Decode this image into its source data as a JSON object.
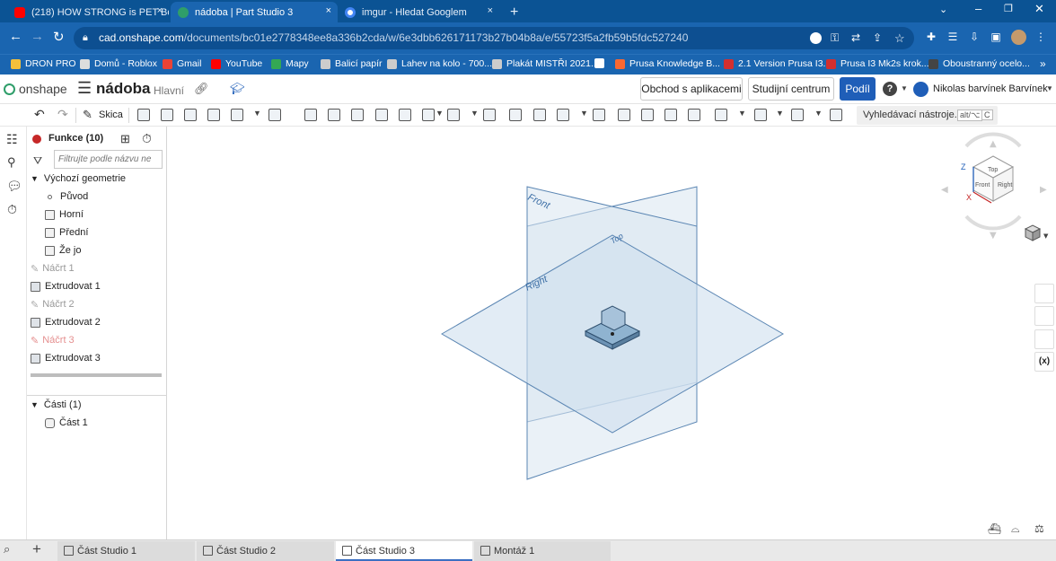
{
  "browser": {
    "tabs": [
      {
        "title": "(218) HOW STRONG is PET Bottle",
        "favicon": "youtube-icon",
        "color": "#ff0000",
        "close": "×"
      },
      {
        "title": "nádoba | Part Studio 3",
        "favicon": "onshape-icon",
        "color": "#2f9e6a",
        "close": "×"
      },
      {
        "title": "imgur - Hledat Googlem",
        "favicon": "google-icon",
        "color": "#ffffff",
        "close": "×"
      }
    ],
    "new_tab": "+",
    "url_host": "cad.onshape.com",
    "url_path": "/documents/bc01e2778348ee8a336b2cda/w/6e3dbb626171173b27b04b8a/e/55723f5a2fb59b5fdc527240",
    "bookmarks": [
      {
        "label": "DRON PRO",
        "color": "#f3c03b"
      },
      {
        "label": "Domů - Roblox",
        "color": "#dddddd"
      },
      {
        "label": "Gmail",
        "color": "#ea4335"
      },
      {
        "label": "YouTube",
        "color": "#ff0000"
      },
      {
        "label": "Mapy",
        "color": "#34a853"
      },
      {
        "label": "Balicí papír",
        "color": "#cccccc"
      },
      {
        "label": "Lahev na kolo - 700...",
        "color": "#cccccc"
      },
      {
        "label": "Plakát MISTŘI 2021...",
        "color": "#cccccc"
      },
      {
        "label": "",
        "color": "#ffffff"
      },
      {
        "label": "Prusa Knowledge B...",
        "color": "#fa6831"
      },
      {
        "label": "2.1 Version Prusa I3...",
        "color": "#d32f2f"
      },
      {
        "label": "Prusa I3 Mk2s krok...",
        "color": "#d32f2f"
      },
      {
        "label": "Oboustranný ocelo...",
        "color": "#444444"
      }
    ],
    "more": "»"
  },
  "onshape": {
    "logo": "onshape",
    "doc_title": "nádoba",
    "branch": "Hlavní",
    "buttons": {
      "store": "Obchod s aplikacemi",
      "learning": "Studijní centrum",
      "share": "Podíl",
      "help": "?"
    },
    "user": "Nikolas barvínek Barvínek",
    "toolbar": {
      "sketch": "Skica",
      "search": "Vyhledávací nástroje...",
      "shortcut": "alt/⌥",
      "shortcut2": "C"
    }
  },
  "features": {
    "header": "Funkce (10)",
    "filter_placeholder": "Filtrujte podle názvu ne",
    "default_geometry": "Výchozí geometrie",
    "items": [
      {
        "label": "Původ",
        "kind": "origin"
      },
      {
        "label": "Horní",
        "kind": "plane"
      },
      {
        "label": "Přední",
        "kind": "plane"
      },
      {
        "label": "Že jo",
        "kind": "plane"
      },
      {
        "label": "Náčrt 1",
        "kind": "sketch"
      },
      {
        "label": "Extrudovat 1",
        "kind": "extrude"
      },
      {
        "label": "Náčrt 2",
        "kind": "sketch"
      },
      {
        "label": "Extrudovat 2",
        "kind": "extrude"
      },
      {
        "label": "Náčrt 3",
        "kind": "sketch-red"
      },
      {
        "label": "Extrudovat 3",
        "kind": "extrude"
      }
    ],
    "parts_header": "Části (1)",
    "parts": [
      "Část 1"
    ]
  },
  "viewport": {
    "plane_labels": {
      "front": "Front",
      "right": "Right",
      "top": "Top"
    },
    "cube": {
      "top": "Top",
      "front": "Front",
      "right": "Right",
      "axis_z": "Z",
      "axis_x": "X"
    }
  },
  "bottom_tabs": [
    {
      "label": "Část Studio 1",
      "active": false
    },
    {
      "label": "Část Studio 2",
      "active": false
    },
    {
      "label": "Část Studio 3",
      "active": true
    },
    {
      "label": "Montáž 1",
      "active": false
    }
  ],
  "colors": {
    "chrome": "#1a65b0",
    "plane": "#c9dcea",
    "plane_edge": "#5b86b3",
    "share": "#1f5eb8"
  }
}
